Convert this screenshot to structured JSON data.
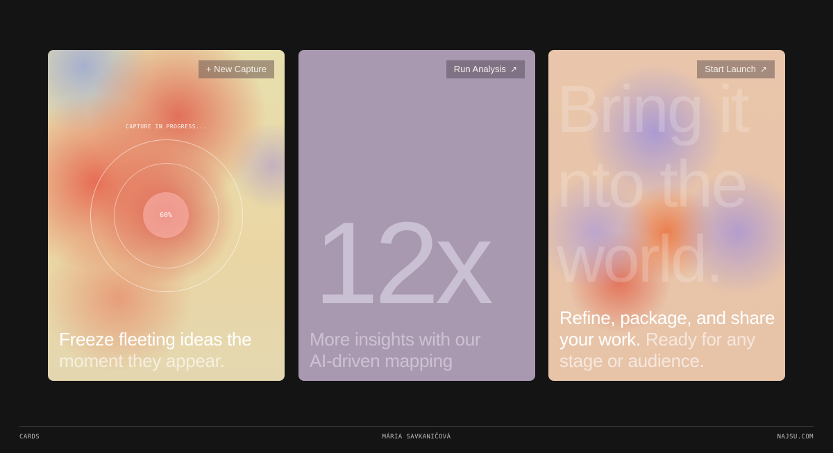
{
  "cards": [
    {
      "button": "+ New Capture",
      "capture_label": "CAPTURE IN PROGRESS...",
      "progress_text": "60%",
      "progress": 0.6,
      "text_strong": "Freeze fleeting ideas the",
      "text_soft": "moment they appear."
    },
    {
      "button": "Run Analysis",
      "button_icon": "arrow-up-right-icon",
      "metric": "12x",
      "text_soft_1": "More insights with our",
      "text_soft_2": "AI-driven mapping"
    },
    {
      "button": "Start Launch",
      "button_icon": "arrow-up-right-icon",
      "bg_words": [
        "Bring it",
        "nto the",
        "world."
      ],
      "text_strong": "Refine, package, and share your work.",
      "text_soft": "Ready for any stage or audience."
    }
  ],
  "footer": {
    "left": "CARDS",
    "center": "MÁRIA SAVKANIČOVÁ",
    "right": "NAJSU.COM"
  },
  "colors": {
    "page_background": "#141414",
    "card_2_background": "#a899b0"
  }
}
